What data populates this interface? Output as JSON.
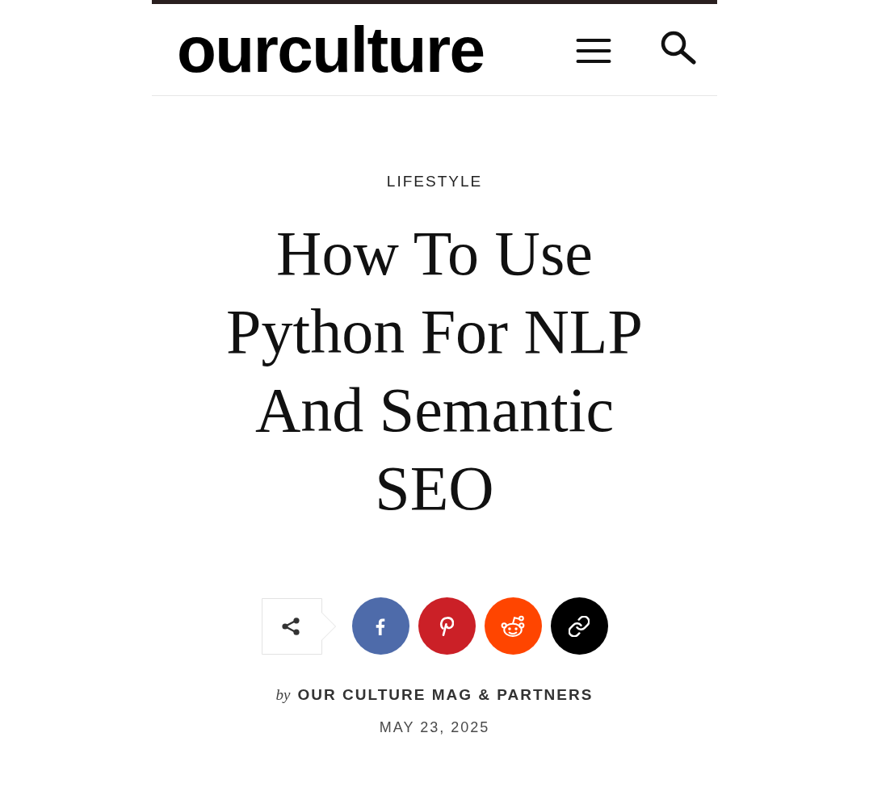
{
  "header": {
    "logo": "ourculture"
  },
  "article": {
    "category": "LIFESTYLE",
    "title": "How To Use Python For NLP And Semantic SEO",
    "share_buttons": [
      {
        "kind": "share"
      },
      {
        "kind": "facebook",
        "color": "#4e6baa"
      },
      {
        "kind": "pinterest",
        "color": "#cb2027"
      },
      {
        "kind": "reddit",
        "color": "#ff4500"
      },
      {
        "kind": "link",
        "color": "#000000"
      }
    ],
    "byline": {
      "prefix": "by",
      "author": "OUR CULTURE MAG & PARTNERS"
    },
    "date": "MAY 23, 2025"
  }
}
